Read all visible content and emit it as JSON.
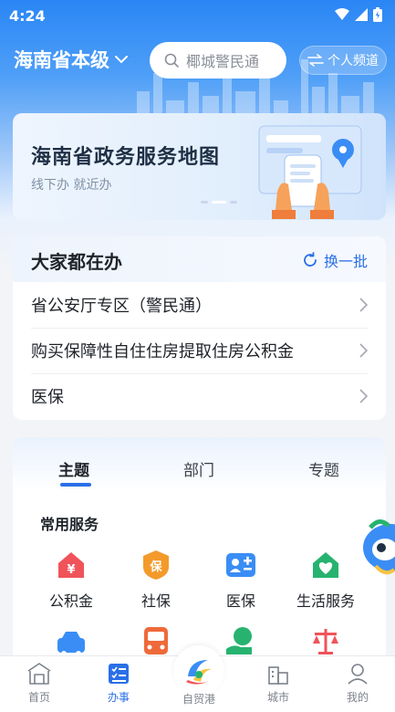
{
  "status_bar": {
    "time": "4:24"
  },
  "header": {
    "region": "海南省本级",
    "search_placeholder": "椰城警民通",
    "channel_label": "个人频道"
  },
  "banner": {
    "title": "海南省政务服务地图",
    "subtitle": "线下办 就近办"
  },
  "popular": {
    "title": "大家都在办",
    "refresh_label": "换一批",
    "items": [
      {
        "label": "省公安厅专区（警民通）"
      },
      {
        "label": "购买保障性自住住房提取住房公积金"
      },
      {
        "label": "医保"
      }
    ]
  },
  "services": {
    "tabs": [
      {
        "label": "主题",
        "active": true
      },
      {
        "label": "部门",
        "active": false
      },
      {
        "label": "专题",
        "active": false
      }
    ],
    "section_label": "常用服务",
    "items": [
      {
        "label": "公积金",
        "icon": "housing-fund-icon",
        "color": "#f0535a"
      },
      {
        "label": "社保",
        "icon": "social-security-icon",
        "color": "#f39a2b"
      },
      {
        "label": "医保",
        "icon": "medical-insurance-icon",
        "color": "#3a8df5"
      },
      {
        "label": "生活服务",
        "icon": "life-service-icon",
        "color": "#27b36f"
      }
    ]
  },
  "tabbar": {
    "items": [
      {
        "label": "首页",
        "icon": "home-icon",
        "active": false
      },
      {
        "label": "办事",
        "icon": "services-icon",
        "active": true
      },
      {
        "label": "自贸港",
        "icon": "free-trade-port-logo-icon",
        "active": false
      },
      {
        "label": "城市",
        "icon": "city-icon",
        "active": false
      },
      {
        "label": "我的",
        "icon": "profile-icon",
        "active": false
      }
    ]
  },
  "colors": {
    "primary": "#2a6fe8",
    "header_blue": "#2a86f5"
  }
}
